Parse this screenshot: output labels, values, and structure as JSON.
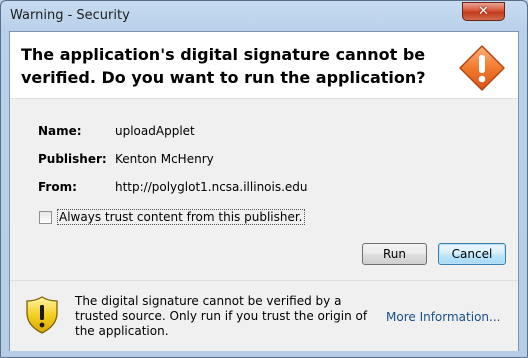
{
  "window": {
    "title": "Warning - Security",
    "close_glyph": "✕"
  },
  "header": {
    "headline": "The application's digital signature cannot be verified.  Do you want to run the application?",
    "icon": "warning-diamond-icon"
  },
  "details": [
    {
      "label": "Name:",
      "value": "uploadApplet"
    },
    {
      "label": "Publisher:",
      "value": "Kenton McHenry"
    },
    {
      "label": "From:",
      "value": "http://polyglot1.ncsa.illinois.edu"
    }
  ],
  "trust_checkbox": {
    "label": "Always trust content from this publisher.",
    "checked": false
  },
  "buttons": {
    "run": "Run",
    "cancel": "Cancel"
  },
  "footer": {
    "icon": "warning-shield-icon",
    "message": "The digital signature cannot be verified by a trusted source.  Only run if you trust the origin of the application.",
    "more_info": "More Information..."
  },
  "colors": {
    "link": "#1a4f8a",
    "warning_orange": "#e8601c",
    "shield_yellow": "#f5d021"
  }
}
